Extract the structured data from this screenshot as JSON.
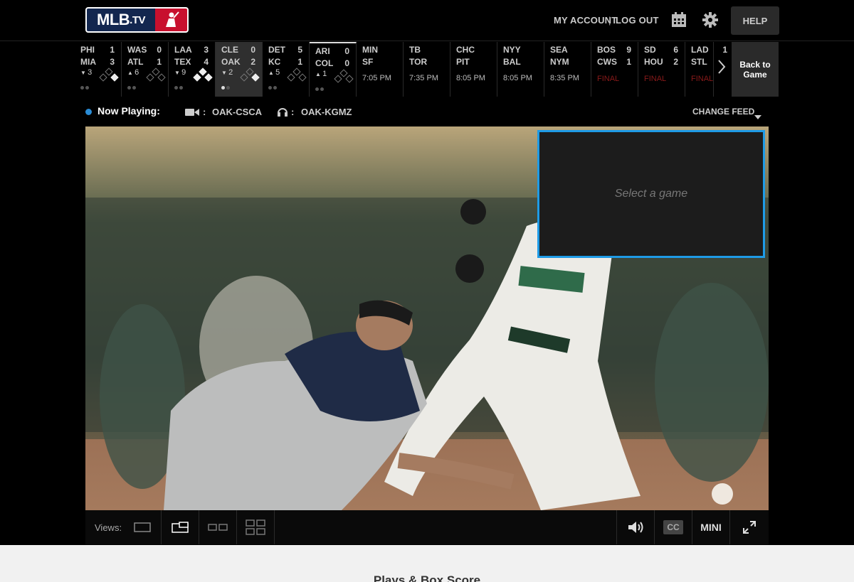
{
  "header": {
    "logo_text": "MLB",
    "logo_suffix": ".TV",
    "my_account": "MY ACCOUNT",
    "separator": "|",
    "log_out": "LOG OUT",
    "calendar_icon": "calendar-icon",
    "settings_icon": "gear-icon",
    "help": "HELP"
  },
  "scoreboard": {
    "games": [
      {
        "away": "PHI",
        "home": "MIA",
        "away_score": "1",
        "home_score": "3",
        "inning": "3",
        "inning_half": "bottom",
        "status": "live"
      },
      {
        "away": "WAS",
        "home": "ATL",
        "away_score": "0",
        "home_score": "1",
        "inning": "6",
        "inning_half": "top",
        "status": "live"
      },
      {
        "away": "LAA",
        "home": "TEX",
        "away_score": "3",
        "home_score": "4",
        "inning": "9",
        "inning_half": "bottom",
        "status": "live"
      },
      {
        "away": "CLE",
        "home": "OAK",
        "away_score": "0",
        "home_score": "2",
        "inning": "2",
        "inning_half": "bottom",
        "status": "live",
        "selected": true
      },
      {
        "away": "DET",
        "home": "KC",
        "away_score": "5",
        "home_score": "1",
        "inning": "5",
        "inning_half": "top",
        "status": "live"
      },
      {
        "away": "ARI",
        "home": "COL",
        "away_score": "0",
        "home_score": "0",
        "inning": "1",
        "inning_half": "top",
        "status": "live"
      },
      {
        "away": "MIN",
        "home": "SF",
        "away_score": "",
        "home_score": "",
        "time": "7:05 PM",
        "status": "scheduled"
      },
      {
        "away": "TB",
        "home": "TOR",
        "away_score": "",
        "home_score": "",
        "time": "7:35 PM",
        "status": "scheduled"
      },
      {
        "away": "CHC",
        "home": "PIT",
        "away_score": "",
        "home_score": "",
        "time": "8:05 PM",
        "status": "scheduled"
      },
      {
        "away": "NYY",
        "home": "BAL",
        "away_score": "",
        "home_score": "",
        "time": "8:05 PM",
        "status": "scheduled"
      },
      {
        "away": "SEA",
        "home": "NYM",
        "away_score": "",
        "home_score": "",
        "time": "8:35 PM",
        "status": "scheduled"
      },
      {
        "away": "BOS",
        "home": "CWS",
        "away_score": "9",
        "home_score": "1",
        "final": "FINAL",
        "status": "final"
      },
      {
        "away": "SD",
        "home": "HOU",
        "away_score": "6",
        "home_score": "2",
        "final": "FINAL",
        "status": "final"
      },
      {
        "away": "LAD",
        "home": "STL",
        "away_score": "1",
        "home_score": "",
        "final": "FINAL",
        "status": "final"
      }
    ],
    "next_icon": "chevron-right-icon",
    "back_to_game": "Back to Game"
  },
  "now_playing": {
    "label": "Now Playing:",
    "video_icon": "video-camera-icon",
    "video_feed": "OAK-CSCA",
    "audio_icon": "headphones-icon",
    "audio_feed": "OAK-KGMZ",
    "colon": ":",
    "change_feed": "CHANGE FEED"
  },
  "player": {
    "pip_placeholder": "Select a game",
    "accent_color": "#1e9be6"
  },
  "controls": {
    "views_label": "Views:",
    "cc": "CC",
    "mini": "MINI"
  },
  "bottom": {
    "section_title": "Plays & Box Score"
  }
}
